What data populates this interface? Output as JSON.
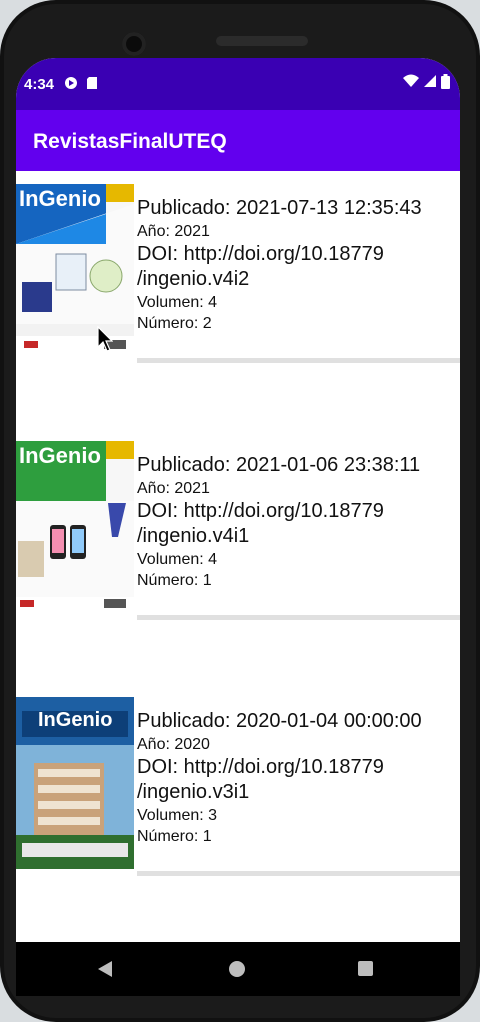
{
  "status_bar": {
    "time": "4:34"
  },
  "app_bar": {
    "title": "RevistasFinalUTEQ"
  },
  "issues": [
    {
      "cover_title": "InGenio",
      "published": "Publicado: 2021-07-13 12:35:43",
      "year": "Año: 2021",
      "doi_line1": "DOI: http://doi.org/10.18779",
      "doi_line2": "/ingenio.v4i2",
      "volume": "Volumen: 4",
      "number": "Número: 2"
    },
    {
      "cover_title": "InGenio",
      "published": "Publicado: 2021-01-06 23:38:11",
      "year": "Año: 2021",
      "doi_line1": "DOI: http://doi.org/10.18779",
      "doi_line2": "/ingenio.v4i1",
      "volume": "Volumen: 4",
      "number": "Número: 1"
    },
    {
      "cover_title": "InGenio",
      "published": "Publicado: 2020-01-04 00:00:00",
      "year": "Año: 2020",
      "doi_line1": "DOI: http://doi.org/10.18779",
      "doi_line2": "/ingenio.v3i1",
      "volume": "Volumen: 3",
      "number": "Número: 1"
    }
  ],
  "colors": {
    "status_bar": "#3a00b3",
    "app_bar": "#6200ee",
    "cover1_band": "#1565c0",
    "cover2_band": "#2e9e3e",
    "cover3_band": "#1d5fa3"
  },
  "icons": [
    "play-protect-icon",
    "sd-card-icon",
    "wifi-icon",
    "signal-icon",
    "battery-icon",
    "back-icon",
    "home-icon",
    "recents-icon",
    "mouse-cursor-icon"
  ]
}
